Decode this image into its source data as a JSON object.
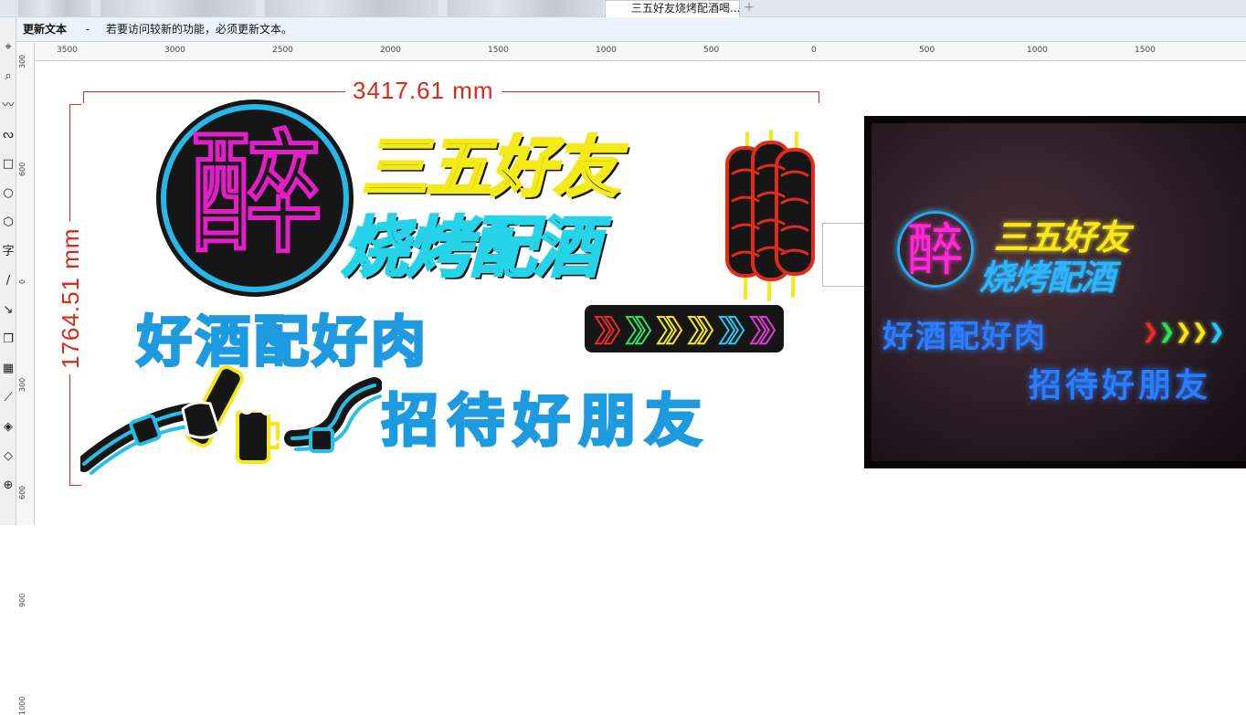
{
  "tabs": {
    "active_label": "三五好友烧烤配酒喝...",
    "add_tab_symbol": "+"
  },
  "infobar": {
    "title": "更新文本",
    "separator": "-",
    "message": "若要访问较新的功能，必须更新文本。"
  },
  "toolbox": {
    "tools": [
      {
        "icon": "pick-tool-icon",
        "glyph": "⌖"
      },
      {
        "icon": "zoom-tool-icon",
        "glyph": "⌕"
      },
      {
        "icon": "freehand-tool-icon",
        "glyph": "〰"
      },
      {
        "icon": "bezier-tool-icon",
        "glyph": "ᔓ"
      },
      {
        "icon": "rectangle-tool-icon",
        "glyph": "□"
      },
      {
        "icon": "ellipse-tool-icon",
        "glyph": "○"
      },
      {
        "icon": "polygon-tool-icon",
        "glyph": "⬡"
      },
      {
        "icon": "text-tool-icon",
        "glyph": "字"
      },
      {
        "icon": "line-tool-icon",
        "glyph": "/"
      },
      {
        "icon": "connector-tool-icon",
        "glyph": "↘"
      },
      {
        "icon": "shadow-tool-icon",
        "glyph": "❐"
      },
      {
        "icon": "transparency-tool-icon",
        "glyph": "▦"
      },
      {
        "icon": "eyedropper-tool-icon",
        "glyph": "⟋"
      },
      {
        "icon": "fill-tool-icon",
        "glyph": "◈"
      },
      {
        "icon": "outline-tool-icon",
        "glyph": "◇"
      },
      {
        "icon": "add-tool-icon",
        "glyph": "⊕"
      }
    ]
  },
  "ruler": {
    "horizontal_labels": [
      "3500",
      "3000",
      "2500",
      "2000",
      "1500",
      "1000",
      "500",
      "0",
      "500",
      "1000",
      "1500"
    ],
    "vertical_labels": [
      "300",
      "600",
      "0",
      "300",
      "600",
      "900",
      "1000"
    ]
  },
  "dimensions": {
    "width_label": "3417.61 mm",
    "height_label": "1764.51 mm"
  },
  "sign": {
    "drunk_char": "醉",
    "line1": "三五好友",
    "line2": "烧烤配酒",
    "line3": "好酒配好肉",
    "line4": "招待好朋友",
    "arrow_glyph": "❯",
    "arrow_colors": [
      "#e82b2b",
      "#2ee05a",
      "#f4e81a",
      "#f4e81a",
      "#28c8f0",
      "#e23ad8"
    ],
    "colors": {
      "yellow": "#f4ea18",
      "cyan": "#25d4e8",
      "blue": "#1e9be0",
      "magenta": "#e21ec6",
      "red": "#e02a1a",
      "dimension_red": "#d42c1a"
    }
  },
  "photo": {
    "drunk_char": "醉",
    "line1": "三五好友",
    "line2": "烧烤配酒",
    "line3": "好酒配好肉",
    "line4": "招待好朋友",
    "arrows": "❯❯❯❯❯"
  }
}
